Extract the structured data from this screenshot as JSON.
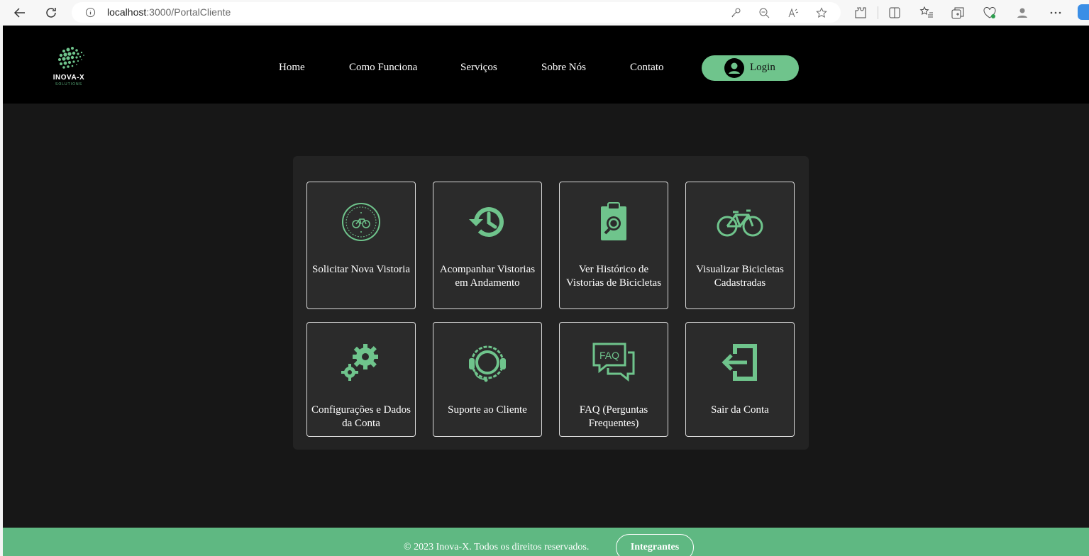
{
  "browser": {
    "url_host": "localhost",
    "url_rest": ":3000/PortalCliente"
  },
  "header": {
    "logo_title": "INOVA-X",
    "logo_subtitle": "SOLUTIONS",
    "nav": [
      "Home",
      "Como Funciona",
      "Serviços",
      "Sobre Nós",
      "Contato"
    ],
    "login_label": "Login"
  },
  "cards": [
    {
      "label": "Solicitar Nova Vistoria",
      "icon": "bike-badge-icon"
    },
    {
      "label": "Acompanhar Vistorias em Andamento",
      "icon": "history-icon"
    },
    {
      "label": "Ver Histórico de Vistorias de Bicicletas",
      "icon": "clipboard-search-icon"
    },
    {
      "label": "Visualizar Bicicletas Cadastradas",
      "icon": "bicycle-icon"
    },
    {
      "label": "Configurações e Dados da Conta",
      "icon": "gears-icon"
    },
    {
      "label": "Suporte ao Cliente",
      "icon": "headset-icon"
    },
    {
      "label": "FAQ (Perguntas Frequentes)",
      "icon": "faq-icon"
    },
    {
      "label": "Sair da Conta",
      "icon": "logout-icon"
    }
  ],
  "footer": {
    "copyright": "© 2023 Inova-X. Todos os direitos reservados.",
    "integrantes": "Integrantes"
  },
  "colors": {
    "accent": "#6fc48c",
    "footer": "#5fb882",
    "page_bg": "#171717",
    "card_bg": "#2b2b2b"
  }
}
